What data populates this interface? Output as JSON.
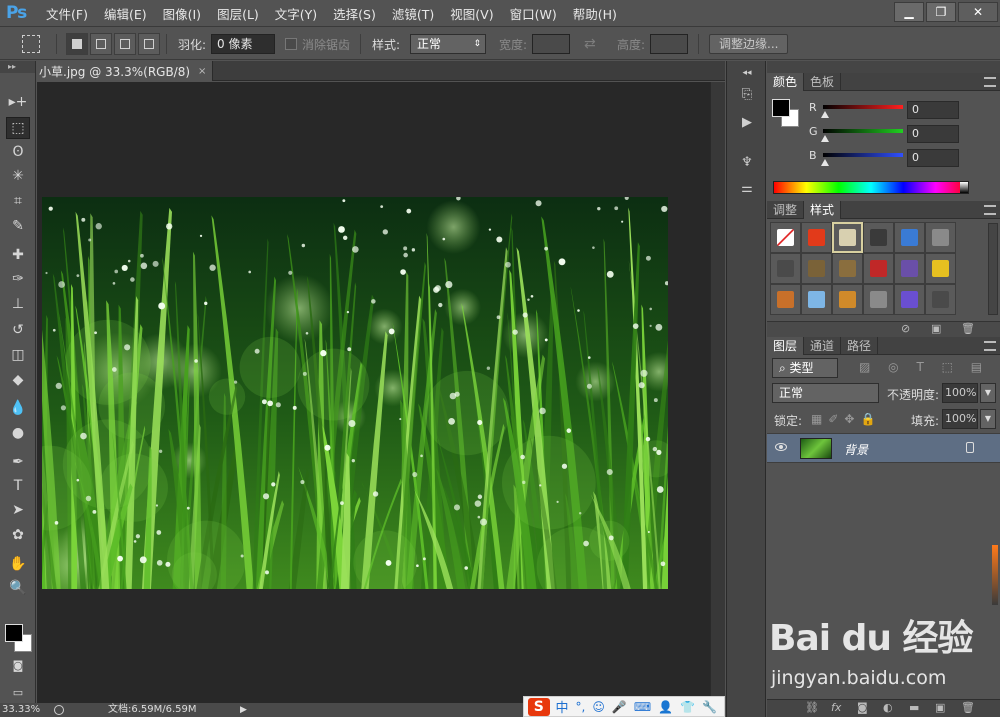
{
  "app": {
    "logo": "Ps"
  },
  "menu": [
    "文件(F)",
    "编辑(E)",
    "图像(I)",
    "图层(L)",
    "文字(Y)",
    "选择(S)",
    "滤镜(T)",
    "视图(V)",
    "窗口(W)",
    "帮助(H)"
  ],
  "window_controls": {
    "minimize": "▁",
    "restore": "❐",
    "close": "✕"
  },
  "options": {
    "feather_label": "羽化:",
    "feather_value": "0 像素",
    "antialias_label": "消除锯齿",
    "style_label": "样式:",
    "style_value": "正常",
    "width_label": "宽度:",
    "height_label": "高度:",
    "refine_button": "调整边缘..."
  },
  "document": {
    "tab_title": "小草.jpg @ 33.3%(RGB/8)",
    "close": "×",
    "status_zoom": "33.33%",
    "status_doc": "文档:6.59M/6.59M"
  },
  "tools": [
    "move-tool",
    "marquee-tool",
    "lasso-tool",
    "magic-wand-tool",
    "crop-tool",
    "eyedropper-tool",
    "healing-brush-tool",
    "brush-tool",
    "clone-stamp-tool",
    "history-brush-tool",
    "eraser-tool",
    "paint-bucket-tool",
    "blur-tool",
    "dodge-tool",
    "pen-tool",
    "type-tool",
    "path-selection-tool",
    "shape-tool",
    "hand-tool",
    "zoom-tool"
  ],
  "tool_glyphs": [
    "▸+",
    "⬚",
    "ʘ",
    "✳",
    "⌗",
    "✎",
    "✚",
    "✑",
    "⊥",
    "↺",
    "◫",
    "◆",
    "💧",
    "●",
    "✒",
    "T",
    "➤",
    "✿",
    "✋",
    "🔍"
  ],
  "color_panel": {
    "tabs": [
      "颜色",
      "色板"
    ],
    "channels": [
      {
        "label": "R",
        "value": "0",
        "color": "#e02020"
      },
      {
        "label": "G",
        "value": "0",
        "color": "#20b020"
      },
      {
        "label": "B",
        "value": "0",
        "color": "#2040e0"
      }
    ]
  },
  "styles_panel": {
    "tabs": [
      "调整",
      "样式"
    ],
    "swatches": [
      "#ffffff",
      "#e23a1a",
      "#d8d0b0",
      "#3a3a3a",
      "#3a7bd5",
      "#8a8a8a",
      "#4a4a4a",
      "#7a6238",
      "#8a6e3e",
      "#c02828",
      "#6a4fa8",
      "#e6c020",
      "#c8702a",
      "#7eb6e6",
      "#d08a2a",
      "#8a8a8a",
      "#6a4fd0",
      "#4a4a4a"
    ]
  },
  "layers_panel": {
    "tabs": [
      "图层",
      "通道",
      "路径"
    ],
    "kind_label": "类型",
    "blend_mode": "正常",
    "opacity_label": "不透明度:",
    "opacity_value": "100%",
    "lock_label": "锁定:",
    "fill_label": "填充:",
    "fill_value": "100%",
    "layers": [
      {
        "name": "背景",
        "visible": true,
        "locked": true
      }
    ]
  },
  "watermark": {
    "logo": "Bai du 经验",
    "url": "jingyan.baidu.com"
  },
  "ime": {
    "logo": "S",
    "mode": "中"
  }
}
